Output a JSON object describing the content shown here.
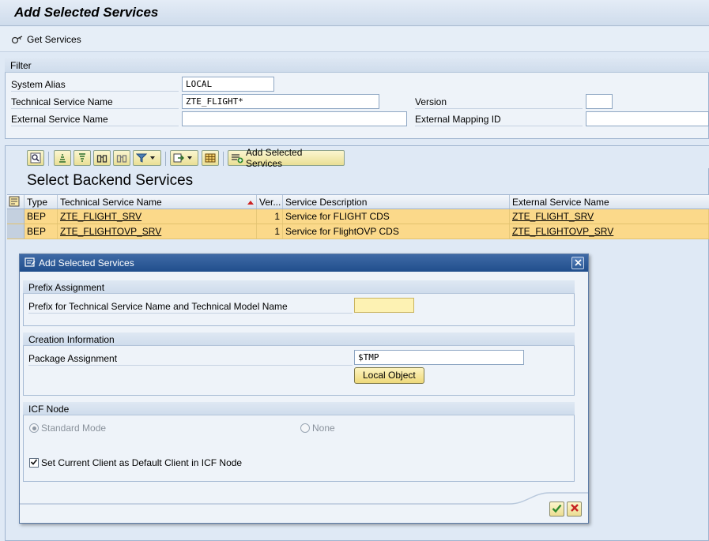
{
  "window": {
    "title": "Add Selected Services",
    "get_services_label": "Get Services"
  },
  "filter": {
    "header": "Filter",
    "system_alias_label": "System Alias",
    "system_alias_value": "LOCAL",
    "tech_service_label": "Technical Service Name",
    "tech_service_value": "ZTE_FLIGHT*",
    "external_service_label": "External Service Name",
    "external_service_value": "",
    "version_label": "Version",
    "version_value": "",
    "external_mapping_label": "External Mapping ID",
    "external_mapping_value": ""
  },
  "results": {
    "toolbar_add_label": "Add Selected Services",
    "list_title": "Select Backend Services",
    "columns": [
      "Type",
      "Technical Service Name",
      "Ver...",
      "Service Description",
      "External Service Name"
    ],
    "rows": [
      {
        "type": "BEP",
        "tech_name": "ZTE_FLIGHT_SRV",
        "version": "1",
        "description": "Service for FLIGHT CDS",
        "external_name": "ZTE_FLIGHT_SRV"
      },
      {
        "type": "BEP",
        "tech_name": "ZTE_FLIGHTOVP_SRV",
        "version": "1",
        "description": "Service for FlightOVP CDS",
        "external_name": "ZTE_FLIGHTOVP_SRV"
      }
    ]
  },
  "dialog": {
    "title": "Add Selected Services",
    "prefix_group": "Prefix Assignment",
    "prefix_label": "Prefix for Technical Service Name and Technical Model Name",
    "prefix_value": "",
    "creation_group": "Creation Information",
    "package_label": "Package Assignment",
    "package_value": "$TMP",
    "local_object_label": "Local Object",
    "icf_group": "ICF Node",
    "standard_mode_label": "Standard Mode",
    "none_label": "None",
    "default_client_label": "Set Current Client as Default Client in ICF Node",
    "default_client_checked": true
  },
  "colors": {
    "selected_row": "#fbd98a",
    "dialog_title_bar": "#204e8c",
    "panel_background": "#dfe9f5"
  }
}
